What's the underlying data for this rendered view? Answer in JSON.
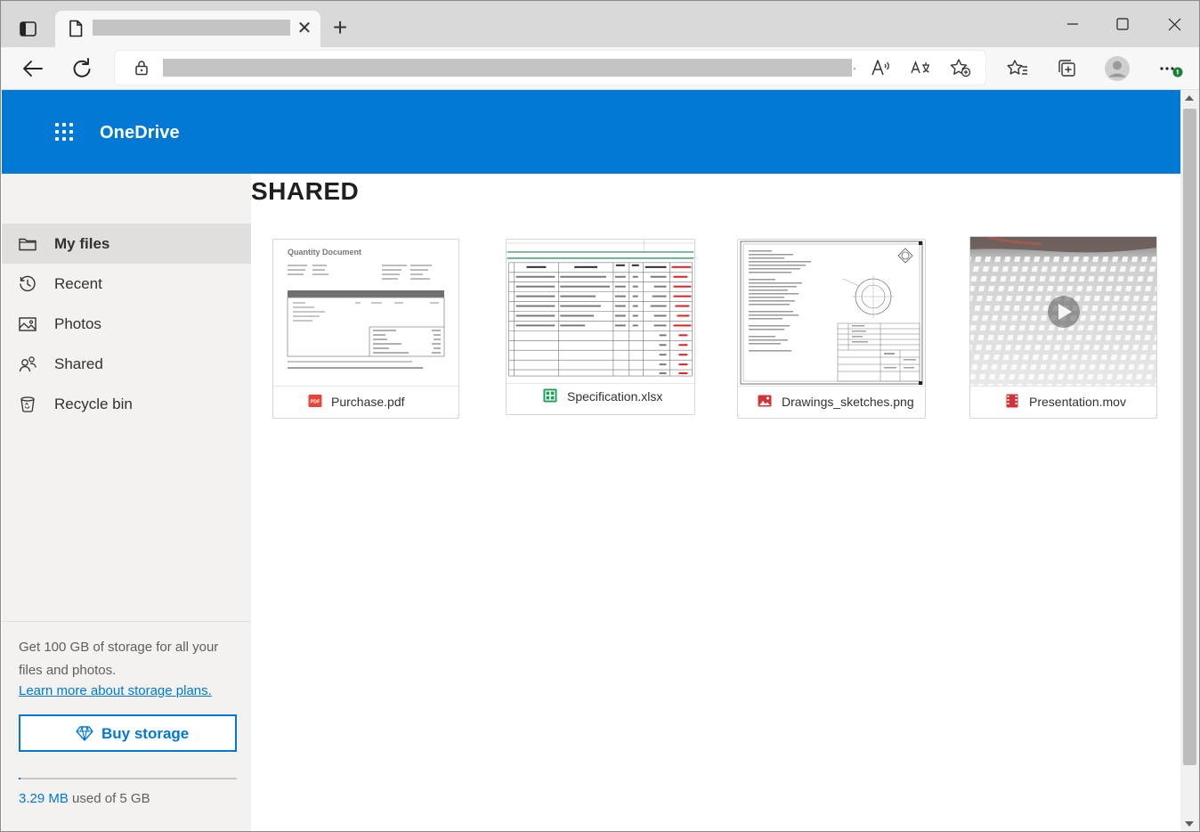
{
  "browser": {
    "tab_title": "",
    "url": "",
    "icons": {
      "tab_actions": "tab-actions-icon",
      "page": "page-icon",
      "close_tab": "close-icon",
      "new_tab": "plus-icon",
      "back": "back-arrow-icon",
      "refresh": "refresh-icon",
      "lock": "lock-icon",
      "read_aloud": "read-aloud-icon",
      "translate": "translate-icon",
      "favorite_add": "star-add-icon",
      "favorites": "favorites-icon",
      "collections": "collections-icon",
      "profile": "profile-icon",
      "more": "more-icon"
    },
    "tab_close_glyph": "✕",
    "new_tab_glyph": "+",
    "url_dot": "."
  },
  "app": {
    "brand": "OneDrive",
    "accent": "#0078d4"
  },
  "sidebar": {
    "items": [
      {
        "label": "My files",
        "icon": "folder-icon",
        "active": true
      },
      {
        "label": "Recent",
        "icon": "clock-icon",
        "active": false
      },
      {
        "label": "Photos",
        "icon": "photo-icon",
        "active": false
      },
      {
        "label": "Shared",
        "icon": "people-icon",
        "active": false
      },
      {
        "label": "Recycle bin",
        "icon": "recycle-bin-icon",
        "active": false
      }
    ],
    "promo": {
      "text": "Get 100 GB of storage for all your files and photos.",
      "link": "Learn more about storage plans.",
      "buy_label": "Buy storage",
      "buy_icon": "diamond-icon"
    },
    "storage": {
      "used": "3.29 MB",
      "suffix": " used of 5 GB",
      "fraction": 0.0007
    }
  },
  "main": {
    "title": "SHARED",
    "files": [
      {
        "name": "Purchase.pdf",
        "icon": "pdf-icon",
        "thumb_title": "Quantity Document"
      },
      {
        "name": "Specification.xlsx",
        "icon": "excel-icon"
      },
      {
        "name": "Drawings_sketches.png",
        "icon": "image-icon"
      },
      {
        "name": "Presentation.mov",
        "icon": "video-icon"
      }
    ]
  }
}
